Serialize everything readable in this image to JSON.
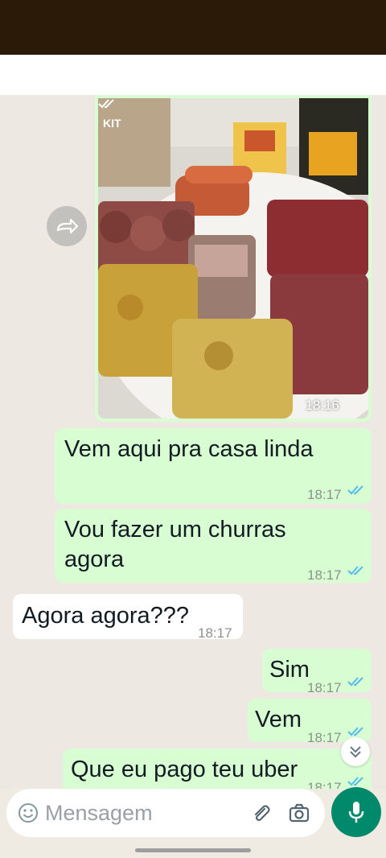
{
  "chat": {
    "image_message": {
      "time": "18:16"
    },
    "messages": [
      {
        "direction": "out",
        "text": "Vem aqui pra casa linda",
        "time": "18:17"
      },
      {
        "direction": "out",
        "text": "Vou fazer um churras",
        "text2": "agora",
        "time": "18:17"
      },
      {
        "direction": "in",
        "text": "Agora agora???",
        "time": "18:17"
      },
      {
        "direction": "out",
        "text": "Sim",
        "time": "18:17"
      },
      {
        "direction": "out",
        "text": "Vem",
        "time": "18:17"
      },
      {
        "direction": "out",
        "text": "Que eu pago teu uber",
        "time": "18:17"
      }
    ]
  },
  "composer": {
    "placeholder": "Mensagem"
  },
  "icons": {
    "forward": "forward-icon",
    "read_ticks": "double-check-icon",
    "scroll_down": "double-chevron-down-icon",
    "emoji": "emoji-icon",
    "attach": "paperclip-icon",
    "camera": "camera-icon",
    "mic": "mic-icon"
  },
  "colors": {
    "outgoing_bubble": "#d9fdd3",
    "incoming_bubble": "#ffffff",
    "chat_background": "#ede8e1",
    "read_tick": "#53bdeb",
    "accent": "#00896b",
    "status_bar": "#2b1a08"
  }
}
